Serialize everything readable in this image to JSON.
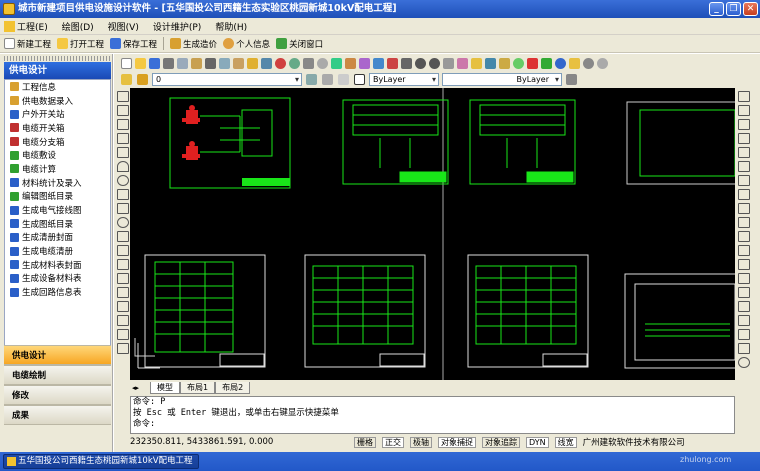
{
  "window": {
    "title": "城市新建项目供电设施设计软件 - [五华国投公司西籍生态实验区桃园新城10kV配电工程]",
    "minimize": "_",
    "restore": "❐",
    "close": "✕"
  },
  "menubar": {
    "items": [
      {
        "label": "工程(E)"
      },
      {
        "label": "绘图(D)"
      },
      {
        "label": "视图(V)"
      },
      {
        "label": "设计维护(P)"
      },
      {
        "label": "帮助(H)"
      }
    ]
  },
  "toolbar": {
    "buttons": [
      {
        "label": "新建工程",
        "color": "#f3f3f3"
      },
      {
        "label": "打开工程",
        "color": "#f5c842"
      },
      {
        "label": "保存工程",
        "color": "#3a6fd8"
      },
      {
        "label": "生成造价",
        "color": "#d8a030"
      },
      {
        "label": "个人信息",
        "color": "#e0a040"
      },
      {
        "label": "关闭窗口",
        "color": "#40a040"
      }
    ]
  },
  "left_panel": {
    "title": "供电设计",
    "items": [
      {
        "label": "工程信息",
        "color": "#d8a030"
      },
      {
        "label": "供电数据录入",
        "color": "#d8a030"
      },
      {
        "label": "户外开关站",
        "color": "#2a5fc8"
      },
      {
        "label": "电缆开关箱",
        "color": "#c03030"
      },
      {
        "label": "电缆分支箱",
        "color": "#c03030"
      },
      {
        "label": "电缆敷设",
        "color": "#30a030"
      },
      {
        "label": "电缆计算",
        "color": "#30a030"
      },
      {
        "label": "材料统计及录入",
        "color": "#2a5fc8"
      },
      {
        "label": "编辑图纸目录",
        "color": "#30a030"
      },
      {
        "label": "生成电气接线图",
        "color": "#2a5fc8"
      },
      {
        "label": "生成图纸目录",
        "color": "#2a5fc8"
      },
      {
        "label": "生成清册封面",
        "color": "#2a5fc8"
      },
      {
        "label": "生成电缆清册",
        "color": "#2a5fc8"
      },
      {
        "label": "生成材料表封面",
        "color": "#2a5fc8"
      },
      {
        "label": "生成设备材料表",
        "color": "#2a5fc8"
      },
      {
        "label": "生成回路信息表",
        "color": "#2a5fc8"
      }
    ],
    "tabs": [
      {
        "label": "供电设计",
        "active": true
      },
      {
        "label": "电缆绘制",
        "active": false
      },
      {
        "label": "修改",
        "active": false
      },
      {
        "label": "成果",
        "active": false
      }
    ]
  },
  "cad": {
    "layer_value": "0",
    "color_value": "ByLayer",
    "linetype_value": "ByLayer",
    "layout_tabs": [
      {
        "label": "模型",
        "active": true
      },
      {
        "label": "布局1",
        "active": false
      },
      {
        "label": "布局2",
        "active": false
      }
    ],
    "command_lines": [
      "命令: P",
      "  按 Esc 或 Enter 键退出，或单击右键显示快捷菜单",
      "命令:"
    ],
    "coords": "232350.811,  5433861.591,  0.000",
    "status_toggles": [
      {
        "label": "栅格",
        "on": false
      },
      {
        "label": "正交",
        "on": true
      },
      {
        "label": "极轴",
        "on": false
      },
      {
        "label": "对象捕捉",
        "on": true
      },
      {
        "label": "对象追踪",
        "on": false
      },
      {
        "label": "DYN",
        "on": true
      },
      {
        "label": "线宽",
        "on": true
      }
    ],
    "company": "广州建软软件技术有限公司"
  },
  "taskbar": {
    "task_label": "五华国投公司西籍生态桃园新城10kV配电工程"
  },
  "watermark": "zhulong.com",
  "colors": {
    "cad_background": "#000000",
    "drawing_green": "#19e619",
    "drawing_red": "#e02020",
    "title_bar": "#2a5fc8",
    "active_tab": "#f7a623"
  }
}
